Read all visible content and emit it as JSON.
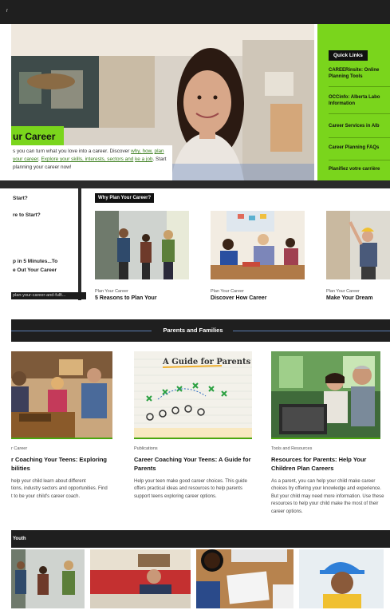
{
  "topbar": {
    "crumb": "r"
  },
  "hero": {
    "title": "ur Career",
    "text_prefix": "s you can turn what you love into a career. Discover ",
    "link_why": "why, ",
    "link_how": "how,",
    "text_2": " ",
    "link_plan": "plan your career",
    "text_3": ". ",
    "link_explore": "Explore your skills, interests, sectors and",
    "text_4": " ",
    "link_job": "ke a job",
    "text_5": ". Start planning your career now!"
  },
  "quick_links": {
    "header": "Quick Links",
    "items": [
      "CAREERinsite: Online Planning Tools",
      "OCCinfo: Alberta Labo Information",
      "Career Services in Alb",
      "Career Planning FAQs",
      "Planifiez votre carrière"
    ]
  },
  "left_card": {
    "q1": "Start?",
    "q2": "re to Start?",
    "q3_line1": "p in 5 Minutes...To",
    "q3_line2": "e Out Your Career",
    "url": "plan-your-career-and-fulfi..."
  },
  "why_section": {
    "header": "Why Plan Your Career?",
    "cards": [
      {
        "meta": "Plan Your Career",
        "title": "5 Reasons to Plan Your"
      },
      {
        "meta": "Plan Your Career",
        "title": "Discover How Career"
      },
      {
        "meta": "Plan Your Career",
        "title": "Make Your Dream"
      }
    ]
  },
  "parents": {
    "header": "Parents and Families",
    "cards": [
      {
        "meta": "r Career",
        "title_1": "r Coaching Your Teens: Exploring",
        "title_2": "bilities",
        "desc_1": "help your child learn about different",
        "desc_2": "tions, industry sectors and opportunities. Find",
        "desc_3": "t to be your child's career coach."
      },
      {
        "meta": "Publications",
        "title_1": "Career Coaching Your Teens: A Guide for",
        "title_2": "Parents",
        "desc_1": "Help your teen make good career choices. This guide",
        "desc_2": "offers practical ideas and resources to help parents",
        "desc_3": "support teens exploring career options.",
        "image_text": "A Guide for Parents"
      },
      {
        "meta": "Tools and Resources",
        "title_1": "Resources for Parents: Help Your",
        "title_2": "Children Plan Careers",
        "desc_1": "As a parent, you can help your child make career",
        "desc_2": "choices by offering your knowledge and experience.",
        "desc_3": "But your child may need more information. Use these",
        "desc_4": "resources to help your child make the most of their",
        "desc_5": "career options."
      }
    ]
  },
  "youth": {
    "header": "Youth"
  },
  "colors": {
    "accent_green": "#7ad51c",
    "dark": "#1f1f1f",
    "link_green": "#3a7d1c"
  }
}
